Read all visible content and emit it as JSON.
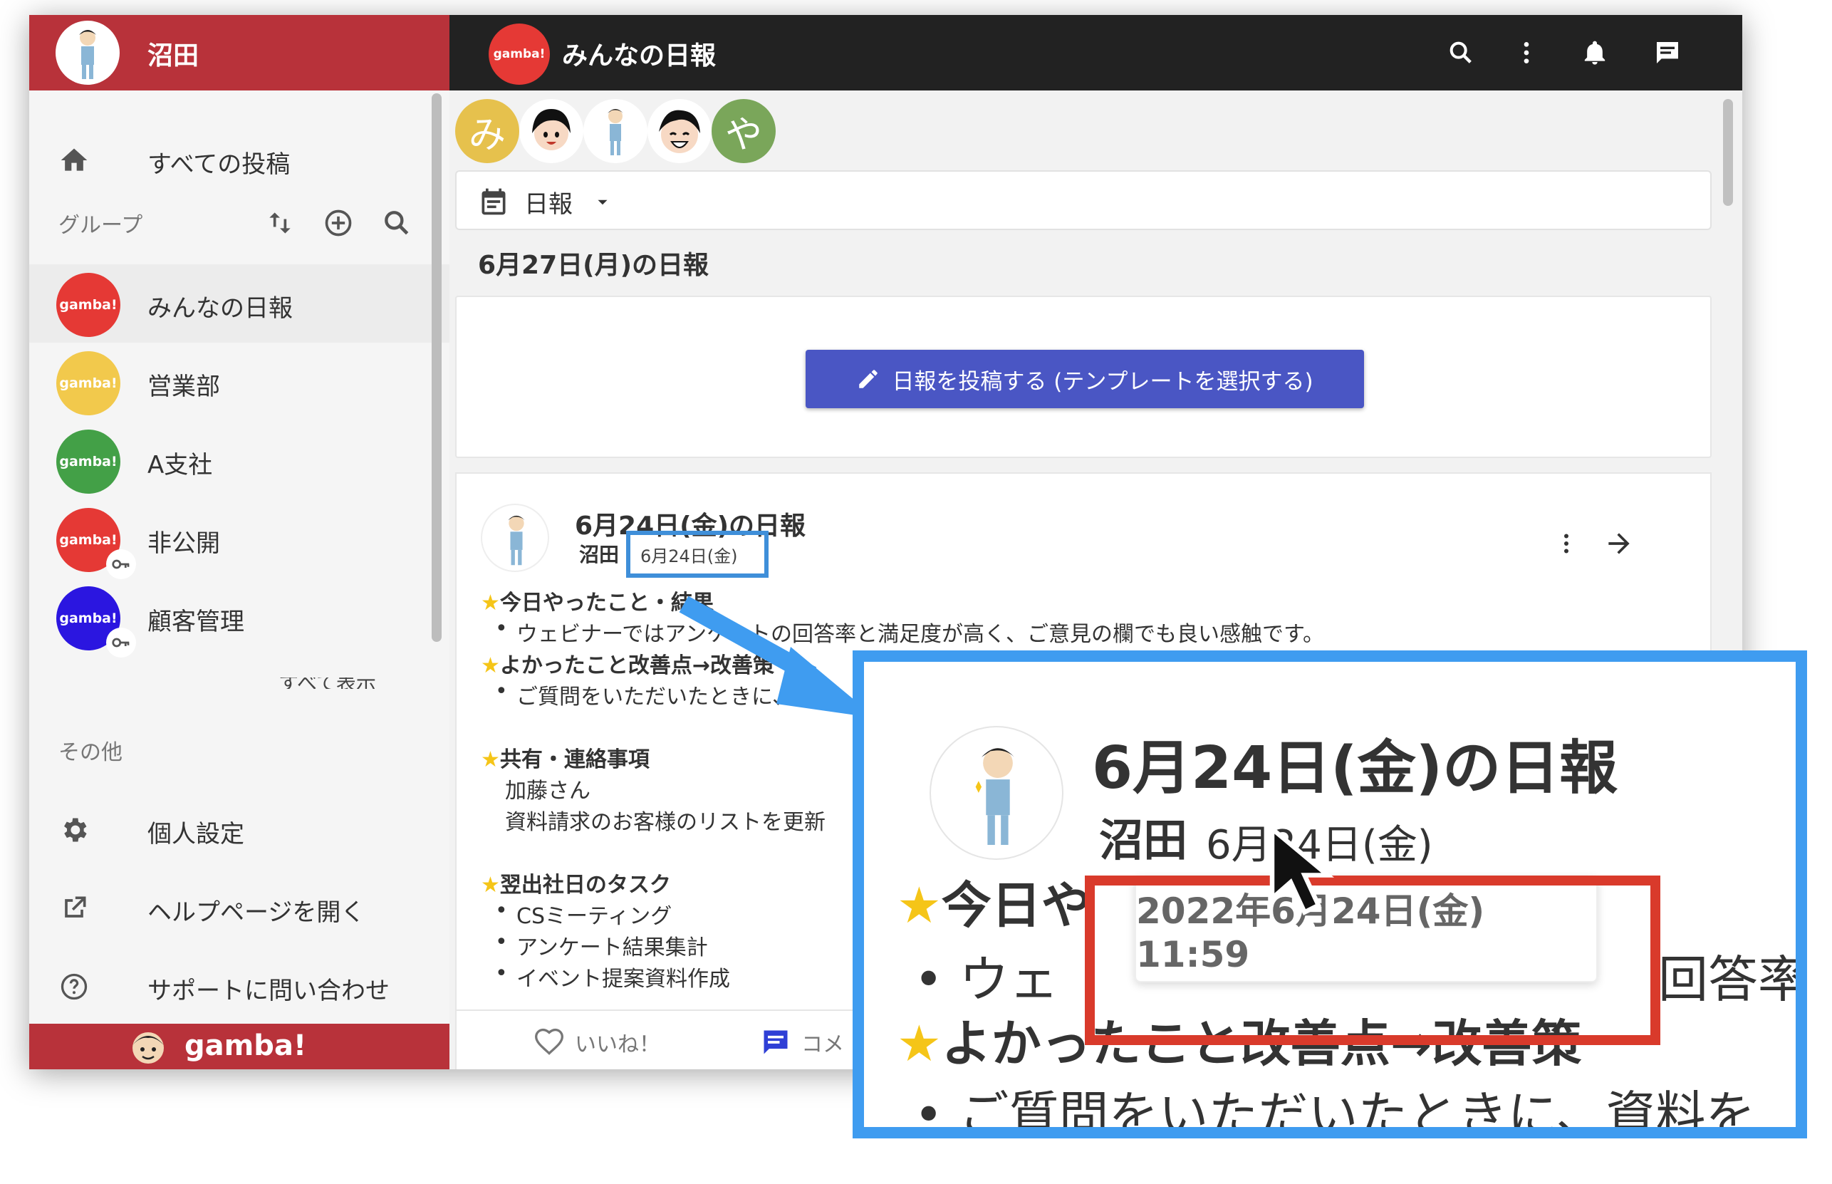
{
  "sidebar": {
    "user_name": "沼田",
    "all_posts": "すべての投稿",
    "groups_label": "グループ",
    "groups": [
      {
        "name": "みんなの日報",
        "badge": "gamba!",
        "color": "#e53935",
        "private": false
      },
      {
        "name": "営業部",
        "badge": "gamba!",
        "color": "#f2c94c",
        "private": false
      },
      {
        "name": "A支社",
        "badge": "gamba!",
        "color": "#43a047",
        "private": false
      },
      {
        "name": "非公開",
        "badge": "gamba!",
        "color": "#e53935",
        "private": true
      },
      {
        "name": "顧客管理",
        "badge": "gamba!",
        "color": "#2b16e0",
        "private": true
      }
    ],
    "show_all": "すべて表示",
    "other_label": "その他",
    "personal_settings": "個人設定",
    "help_page": "ヘルプページを開く",
    "contact_support": "サポートに問い合わせ",
    "footer_brand": "gamba!"
  },
  "topbar": {
    "logo": "gamba!",
    "title": "みんなの日報",
    "icons": [
      "search-icon",
      "more-vert-icon",
      "bell-icon",
      "chat-icon"
    ]
  },
  "members": [
    {
      "initial": "み",
      "color": "#e6c14d"
    },
    {
      "initial": "",
      "color": "#ffffff"
    },
    {
      "initial": "",
      "color": "#ffffff"
    },
    {
      "initial": "",
      "color": "#ffffff"
    },
    {
      "initial": "や",
      "color": "#7aa65a"
    }
  ],
  "template_select": {
    "label": "日報"
  },
  "date_heading": "6月27日(月)の日報",
  "post_button": "日報を投稿する (テンプレートを選択する)",
  "entry": {
    "title": "6月24日(金)の日報",
    "author": "沼田",
    "date": "6月24日(金)",
    "sections": [
      {
        "heading": "今日やったこと・結果",
        "items": [
          "ウェビナーではアンケートの回答率と満足度が高く、ご意見の欄でも良い感触です。"
        ]
      },
      {
        "heading": "よかったこと改善点→改善策",
        "items": [
          "ご質問をいただいたときに、資料"
        ]
      },
      {
        "heading": "共有・連絡事項",
        "lines": [
          "加藤さん",
          "資料請求のお客様のリストを更新"
        ]
      },
      {
        "heading": "翌出社日のタスク",
        "items": [
          "CSミーティング",
          "アンケート結果集計",
          "イベント提案資料作成"
        ]
      }
    ],
    "like_label": "いいね！",
    "comment_label": "コメ"
  },
  "zoom": {
    "title": "6月24日(金)の日報",
    "author": "沼田",
    "date": "6月24日(金)",
    "tooltip": "2022年6月24日(金) 11:59",
    "line1": "今日や",
    "line2": "ウェ",
    "line2_tail": "回答率",
    "line3": "よかったこと改善点→改善策",
    "line4": "ご質問をいただいたときに、資料を"
  }
}
